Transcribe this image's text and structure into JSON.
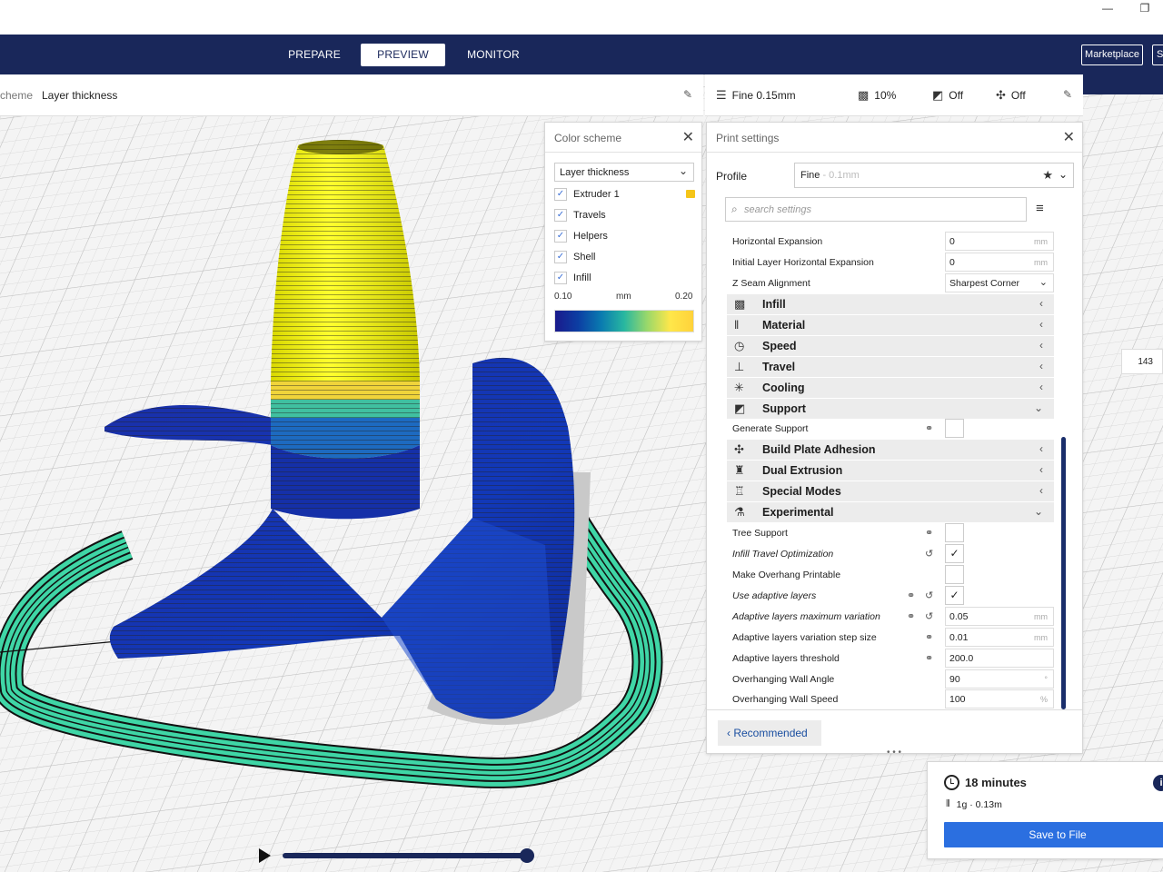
{
  "window": {
    "minimize": "—",
    "restore": "❐"
  },
  "stages": [
    {
      "label": "PREPARE"
    },
    {
      "label": "PREVIEW"
    },
    {
      "label": "MONITOR"
    }
  ],
  "marketplace_label": "Marketplace",
  "account_label": "S",
  "view_header": {
    "prefix": "cheme",
    "value": "Layer thickness"
  },
  "print_header": {
    "profile": "Fine 0.15mm",
    "infill": "10%",
    "support": "Off",
    "adhesion": "Off"
  },
  "color_scheme": {
    "title": "Color scheme",
    "selected": "Layer thickness",
    "items": [
      {
        "label": "Extruder 1",
        "checked": true
      },
      {
        "label": "Travels",
        "checked": true
      },
      {
        "label": "Helpers",
        "checked": true
      },
      {
        "label": "Shell",
        "checked": true
      },
      {
        "label": "Infill",
        "checked": true
      }
    ],
    "legend_min": "0.10",
    "legend_unit": "mm",
    "legend_max": "0.20",
    "extruder_color": "#f5c518"
  },
  "print_settings": {
    "title": "Print settings",
    "profile_label": "Profile",
    "profile_value": "Fine",
    "profile_hint": " - 0.1mm",
    "search_placeholder": "search settings",
    "rows_top": [
      {
        "label": "Horizontal Expansion",
        "value": "0",
        "unit": "mm"
      },
      {
        "label": "Initial Layer Horizontal Expansion",
        "value": "0",
        "unit": "mm"
      },
      {
        "label": "Z Seam Alignment",
        "value": "Sharpest Corner"
      }
    ],
    "categories": [
      {
        "label": "Infill",
        "icon": "infill-icon"
      },
      {
        "label": "Material",
        "icon": "material-icon"
      },
      {
        "label": "Speed",
        "icon": "speed-icon"
      },
      {
        "label": "Travel",
        "icon": "travel-icon"
      },
      {
        "label": "Cooling",
        "icon": "cooling-icon"
      },
      {
        "label": "Support",
        "icon": "support-icon"
      }
    ],
    "generate_support": "Generate Support",
    "categories2": [
      {
        "label": "Build Plate Adhesion",
        "icon": "adhesion-icon"
      },
      {
        "label": "Dual Extrusion",
        "icon": "dual-extrusion-icon"
      },
      {
        "label": "Special Modes",
        "icon": "special-modes-icon"
      },
      {
        "label": "Experimental",
        "icon": "experimental-icon"
      }
    ],
    "experimental_rows": [
      {
        "label": "Tree Support"
      },
      {
        "label": "Infill Travel Optimization"
      },
      {
        "label": "Make Overhang Printable"
      },
      {
        "label": "Use adaptive layers"
      },
      {
        "label": "Adaptive layers maximum variation",
        "value": "0.05",
        "unit": "mm"
      },
      {
        "label": "Adaptive layers variation step size",
        "value": "0.01",
        "unit": "mm"
      },
      {
        "label": "Adaptive layers threshold",
        "value": "200.0"
      },
      {
        "label": "Overhanging Wall Angle",
        "value": "90",
        "unit": "°"
      },
      {
        "label": "Overhanging Wall Speed",
        "value": "100",
        "unit": "%"
      }
    ],
    "check_mark": "✓",
    "recommended_label": "Recommended"
  },
  "action": {
    "time": "18 minutes",
    "material": "1g · 0.13m",
    "info": "i",
    "save_label": "Save to File"
  },
  "side_number": "143"
}
